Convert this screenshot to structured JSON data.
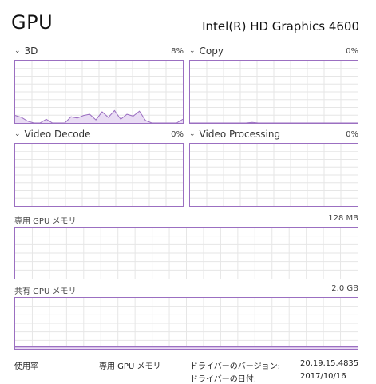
{
  "header": {
    "title": "GPU",
    "adapter": "Intel(R) HD Graphics 4600"
  },
  "engines": [
    {
      "label": "3D",
      "value": "8%",
      "series": [
        0.12,
        0.09,
        0.03,
        0.0,
        0.0,
        0.06,
        0.0,
        0.0,
        0.0,
        0.1,
        0.08,
        0.12,
        0.14,
        0.05,
        0.18,
        0.09,
        0.2,
        0.06,
        0.14,
        0.11,
        0.19,
        0.04,
        0.0,
        0.0,
        0.0,
        0.0,
        0.0,
        0.06
      ]
    },
    {
      "label": "Copy",
      "value": "0%",
      "series": [
        0,
        0,
        0,
        0,
        0,
        0,
        0,
        0,
        0,
        0,
        0.01,
        0,
        0,
        0,
        0,
        0,
        0,
        0,
        0,
        0,
        0,
        0,
        0,
        0,
        0,
        0,
        0,
        0
      ]
    },
    {
      "label": "Video Decode",
      "value": "0%",
      "series": []
    },
    {
      "label": "Video Processing",
      "value": "0%",
      "series": []
    }
  ],
  "dedicated_memory": {
    "label": "専用 GPU メモリ",
    "value": "128 MB",
    "level": 0
  },
  "shared_memory": {
    "label": "共有 GPU メモリ",
    "value": "2.0 GB",
    "level": 0.04
  },
  "footer": {
    "usage_label": "使用率",
    "dedicated_label": "専用 GPU メモリ",
    "driver_version_label": "ドライバーのバージョン:",
    "driver_version_value": "20.19.15.4835",
    "driver_date_label": "ドライバーの日付:",
    "driver_date_value": "2017/10/16"
  },
  "colors": {
    "accent": "#9b6fc1",
    "fill": "#e9dcf4",
    "grid": "#e6e6e6"
  }
}
